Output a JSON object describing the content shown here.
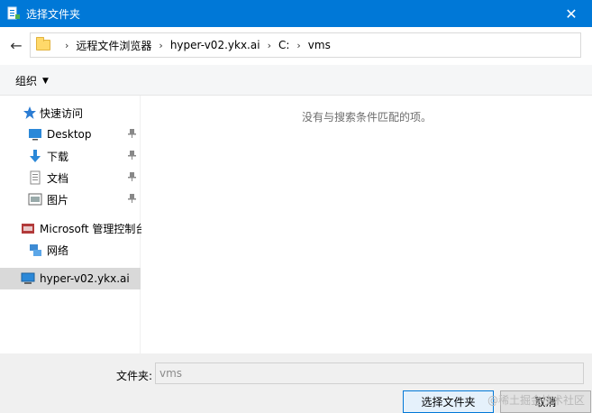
{
  "window": {
    "title": "选择文件夹",
    "close_glyph": "✕"
  },
  "address": {
    "back_glyph": "←",
    "separator": "›",
    "crumbs": [
      "远程文件浏览器",
      "hyper-v02.ykx.ai",
      "C:",
      "vms"
    ]
  },
  "toolbar": {
    "organize_label": "组织",
    "caret": "▼"
  },
  "nav": {
    "quick_access": "快速访问",
    "items": [
      {
        "label": "Desktop",
        "icon": "desktop-icon"
      },
      {
        "label": "下载",
        "icon": "download-icon"
      },
      {
        "label": "文档",
        "icon": "document-icon"
      },
      {
        "label": "图片",
        "icon": "picture-icon"
      }
    ],
    "pin_glyph": "📌",
    "mmc": "Microsoft 管理控制台",
    "network": "网络",
    "selected_host": "hyper-v02.ykx.ai"
  },
  "main": {
    "empty_message": "没有与搜索条件匹配的项。"
  },
  "footer": {
    "folder_label": "文件夹:",
    "folder_value": "vms",
    "select_button": "选择文件夹",
    "cancel_button": "取消"
  },
  "watermark": "@稀土掘金技术社区",
  "colors": {
    "titlebar": "#0078d7",
    "selected_row": "#d9d9d9",
    "footer_bg": "#f0f0f0"
  }
}
